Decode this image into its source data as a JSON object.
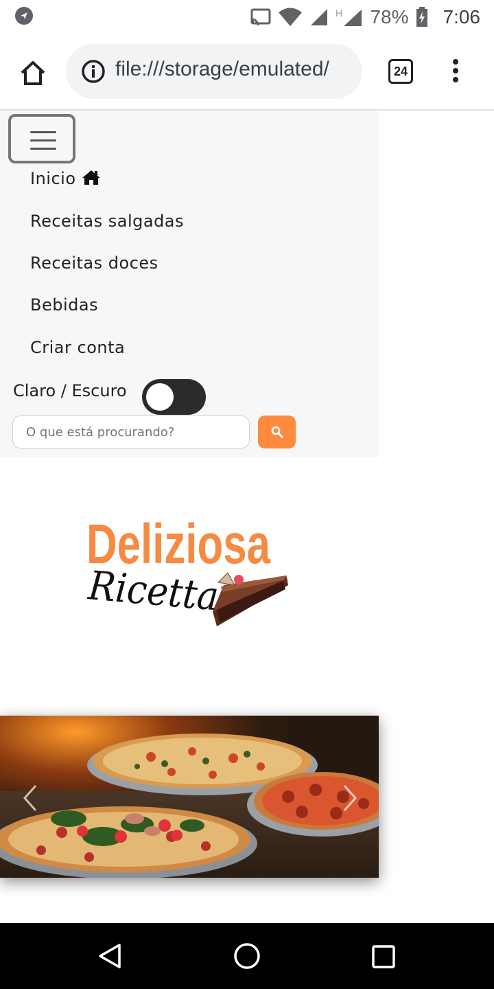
{
  "status_bar": {
    "battery_percent": "78%",
    "time": "7:06",
    "icons": [
      "app-notification-icon",
      "cast-icon",
      "wifi-icon",
      "signal-icon",
      "hspa-signal-icon",
      "battery-charging-icon"
    ]
  },
  "browser": {
    "url": "file:///storage/emulated/",
    "tab_count": "24",
    "icons": [
      "home-icon",
      "info-icon",
      "tabs-icon",
      "more-vert-icon"
    ]
  },
  "nav": {
    "items": [
      {
        "label": "Inicio",
        "icon": "house-icon"
      },
      {
        "label": "Receitas salgadas"
      },
      {
        "label": "Receitas doces"
      },
      {
        "label": "Bebidas"
      },
      {
        "label": "Criar conta"
      }
    ],
    "theme_toggle_label": "Claro / Escuro",
    "theme_toggle_on": false,
    "search_placeholder": "O que está procurando?",
    "search_button_icon": "search-icon"
  },
  "logo": {
    "line1": "Deliziosa",
    "line2": "Ricetta",
    "colors": {
      "line1": "#f58a43",
      "line2": "#111111"
    }
  },
  "carousel": {
    "image": "pizzas-photo",
    "prev_icon": "chevron-left-icon",
    "next_icon": "chevron-right-icon"
  },
  "colors": {
    "accent": "#ff8a3d",
    "nav_background": "#f6f7f9",
    "toggle_dark": "#2b2b2b"
  },
  "system_nav": {
    "icons": [
      "back-icon",
      "home-circle-icon",
      "recents-icon"
    ]
  }
}
